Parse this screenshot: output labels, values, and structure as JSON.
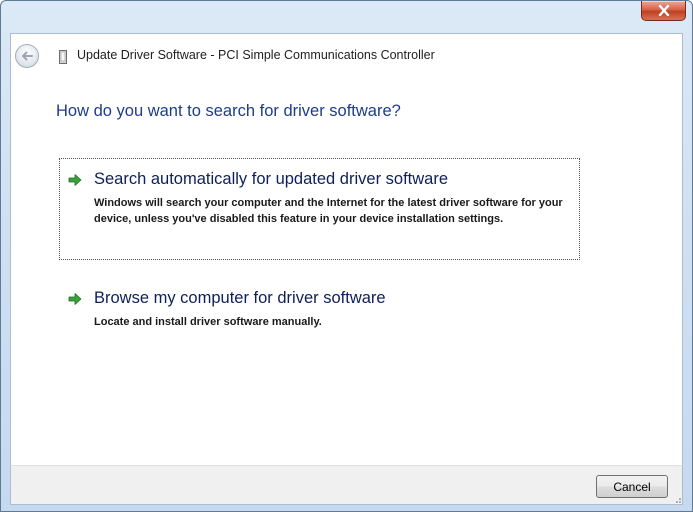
{
  "window": {
    "title": "Update Driver Software - PCI Simple Communications Controller",
    "close_label": "x"
  },
  "main": {
    "question": "How do you want to search for driver software?",
    "options": [
      {
        "title": "Search automatically for updated driver software",
        "description": "Windows will search your computer and the Internet for the latest driver software for your device, unless you've disabled this feature in your device installation settings.",
        "icon": "green-arrow-icon"
      },
      {
        "title": "Browse my computer for driver software",
        "description": "Locate and install driver software manually.",
        "icon": "green-arrow-icon"
      }
    ]
  },
  "footer": {
    "cancel_label": "Cancel"
  },
  "colors": {
    "heading_blue": "#1c3d8c",
    "option_title": "#0e1f5a",
    "arrow_green": "#3aa23a",
    "close_red": "#c0401f"
  }
}
